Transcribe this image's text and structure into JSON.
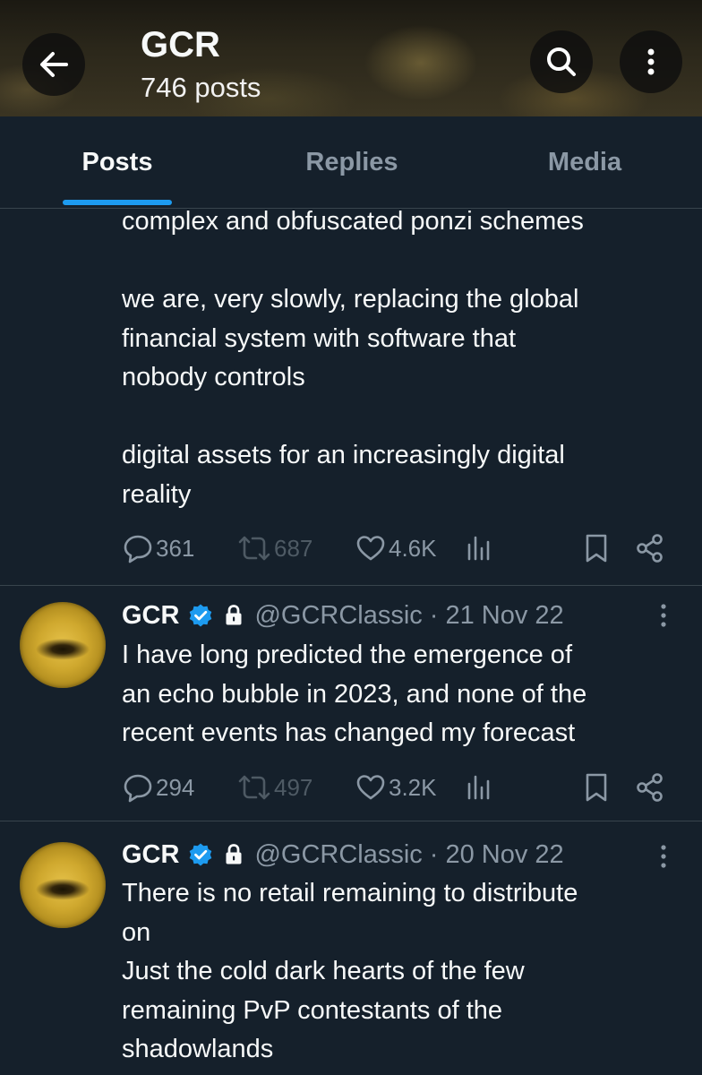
{
  "header": {
    "title": "GCR",
    "subtitle": "746 posts"
  },
  "tabs": [
    {
      "label": "Posts",
      "active": true
    },
    {
      "label": "Replies",
      "active": false
    },
    {
      "label": "Media",
      "active": false
    }
  ],
  "colors": {
    "background": "#15202b",
    "accent": "#1d9bf0",
    "muted_text": "#8b98a5",
    "divider": "#38444d"
  },
  "post0": {
    "paragraphs": [
      "complex and obfuscated ponzi schemes",
      "we are, very slowly, replacing the global\nfinancial system with software that\nnobody controls",
      "digital assets for an increasingly digital\nreality"
    ],
    "stats": {
      "replies": "361",
      "reposts": "687",
      "likes": "4.6K"
    }
  },
  "tweets": [
    {
      "name": "GCR",
      "handle": "@GCRClassic",
      "separator": "·",
      "date": "21 Nov 22",
      "text": "I have long predicted the emergence of\nan echo bubble in 2023, and none of the\nrecent events has changed my forecast",
      "stats": {
        "replies": "294",
        "reposts": "497",
        "likes": "3.2K"
      }
    },
    {
      "name": "GCR",
      "handle": "@GCRClassic",
      "separator": "·",
      "date": "20 Nov 22",
      "text": "There is no retail remaining to distribute\non\nJust the cold dark hearts of the few\nremaining PvP contestants of the\nshadowlands"
    }
  ]
}
